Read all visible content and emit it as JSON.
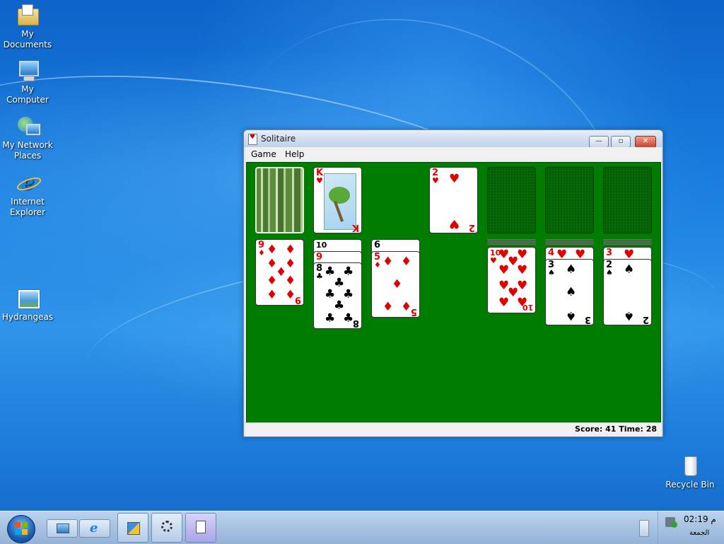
{
  "desktop": {
    "icons": [
      {
        "label_line1": "My",
        "label_line2": "Documents",
        "icon": "folder-documents-icon"
      },
      {
        "label_line1": "My Computer",
        "label_line2": "",
        "icon": "computer-icon"
      },
      {
        "label_line1": "My Network",
        "label_line2": "Places",
        "icon": "network-icon"
      },
      {
        "label_line1": "Internet",
        "label_line2": "Explorer",
        "icon": "internet-explorer-icon"
      },
      {
        "label_line1": "Hydrangeas",
        "label_line2": "",
        "icon": "image-file-icon"
      },
      {
        "label_line1": "Recycle Bin",
        "label_line2": "",
        "icon": "recycle-bin-icon"
      }
    ]
  },
  "window": {
    "title": "Solitaire",
    "menu": [
      "Game",
      "Help"
    ],
    "status": "Score: 41  Time: 28",
    "controls": {
      "minimize": "—",
      "maximize": "▫",
      "close": "✕"
    }
  },
  "game": {
    "stock": {
      "face": "back"
    },
    "waste": {
      "rank": "K",
      "suit": "♥",
      "color": "red"
    },
    "foundations": [
      {
        "rank": "2",
        "suit": "♥",
        "color": "red"
      },
      {
        "empty": true
      },
      {
        "empty": true
      },
      {
        "empty": true
      }
    ],
    "tableau": [
      {
        "cards": [
          {
            "rank": "9",
            "suit": "♦",
            "color": "red"
          }
        ]
      },
      {
        "cards": [
          {
            "rank": "10",
            "suit": "♠",
            "color": "black"
          },
          {
            "rank": "9",
            "suit": "♥",
            "color": "red"
          },
          {
            "rank": "8",
            "suit": "♣",
            "color": "black"
          }
        ]
      },
      {
        "cards": [
          {
            "rank": "6",
            "suit": "♠",
            "color": "black"
          },
          {
            "rank": "5",
            "suit": "♦",
            "color": "red"
          }
        ]
      },
      {
        "cards": []
      },
      {
        "cards": [
          {
            "rank": "10",
            "suit": "♥",
            "color": "red"
          }
        ]
      },
      {
        "cards": [
          {
            "rank": "4",
            "suit": "♥",
            "color": "red"
          },
          {
            "rank": "3",
            "suit": "♠",
            "color": "black"
          }
        ]
      },
      {
        "cards": [
          {
            "rank": "3",
            "suit": "♥",
            "color": "red"
          },
          {
            "rank": "2",
            "suit": "♠",
            "color": "black"
          }
        ]
      }
    ]
  },
  "taskbar": {
    "clock_time": "02:19 م",
    "clock_day": "الجمعة"
  },
  "colors": {
    "felt": "#007d00",
    "card_red": "#e00000"
  }
}
